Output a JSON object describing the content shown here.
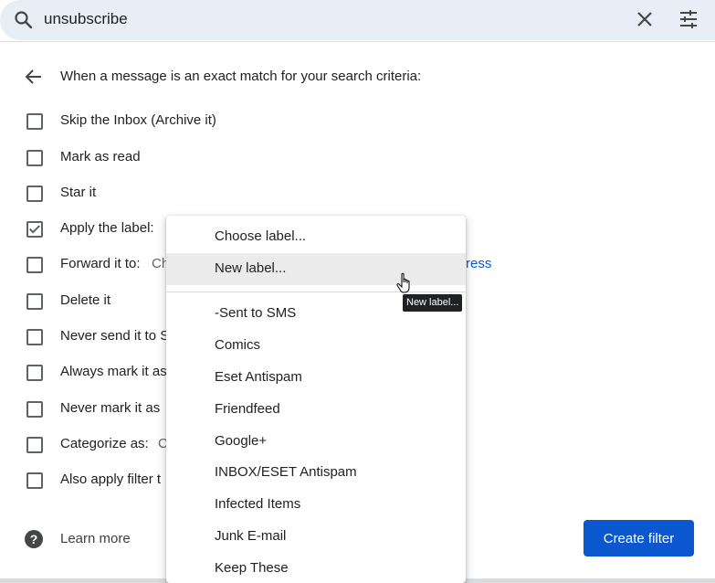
{
  "search": {
    "query": "unsubscribe",
    "icons": {
      "search": "search-icon",
      "clear": "close-icon",
      "options": "tune-icon"
    }
  },
  "criteria_title": "When a message is an exact match for your search criteria:",
  "options": [
    {
      "label": "Skip the Inbox (Archive it)",
      "checked": false
    },
    {
      "label": "Mark as read",
      "checked": false
    },
    {
      "label": "Star it",
      "checked": false
    },
    {
      "label": "Apply the label:",
      "checked": true
    },
    {
      "label": "Forward it to:",
      "checked": false,
      "extra": "Ch",
      "link": "ress"
    },
    {
      "label": "Delete it",
      "checked": false
    },
    {
      "label": "Never send it to S",
      "checked": false
    },
    {
      "label": "Always mark it as",
      "checked": false
    },
    {
      "label": "Never mark it as",
      "checked": false
    },
    {
      "label": "Categorize as:",
      "checked": false,
      "extra": "C"
    },
    {
      "label": "Also apply filter t",
      "checked": false
    }
  ],
  "footer": {
    "learn_more": "Learn more",
    "create_filter": "Create filter"
  },
  "dropdown": {
    "items_top": [
      "Choose label...",
      "New label..."
    ],
    "items_labels": [
      "-Sent to SMS",
      "Comics",
      "Eset Antispam",
      "Friendfeed",
      "Google+",
      "INBOX/ESET Antispam",
      "Infected Items",
      "Junk E-mail",
      "Keep These"
    ],
    "hovered": "New label..."
  },
  "tooltip": "New label...",
  "colors": {
    "accent": "#0b57d0",
    "searchbar": "#e9eef6",
    "hover": "#ebebeb"
  }
}
